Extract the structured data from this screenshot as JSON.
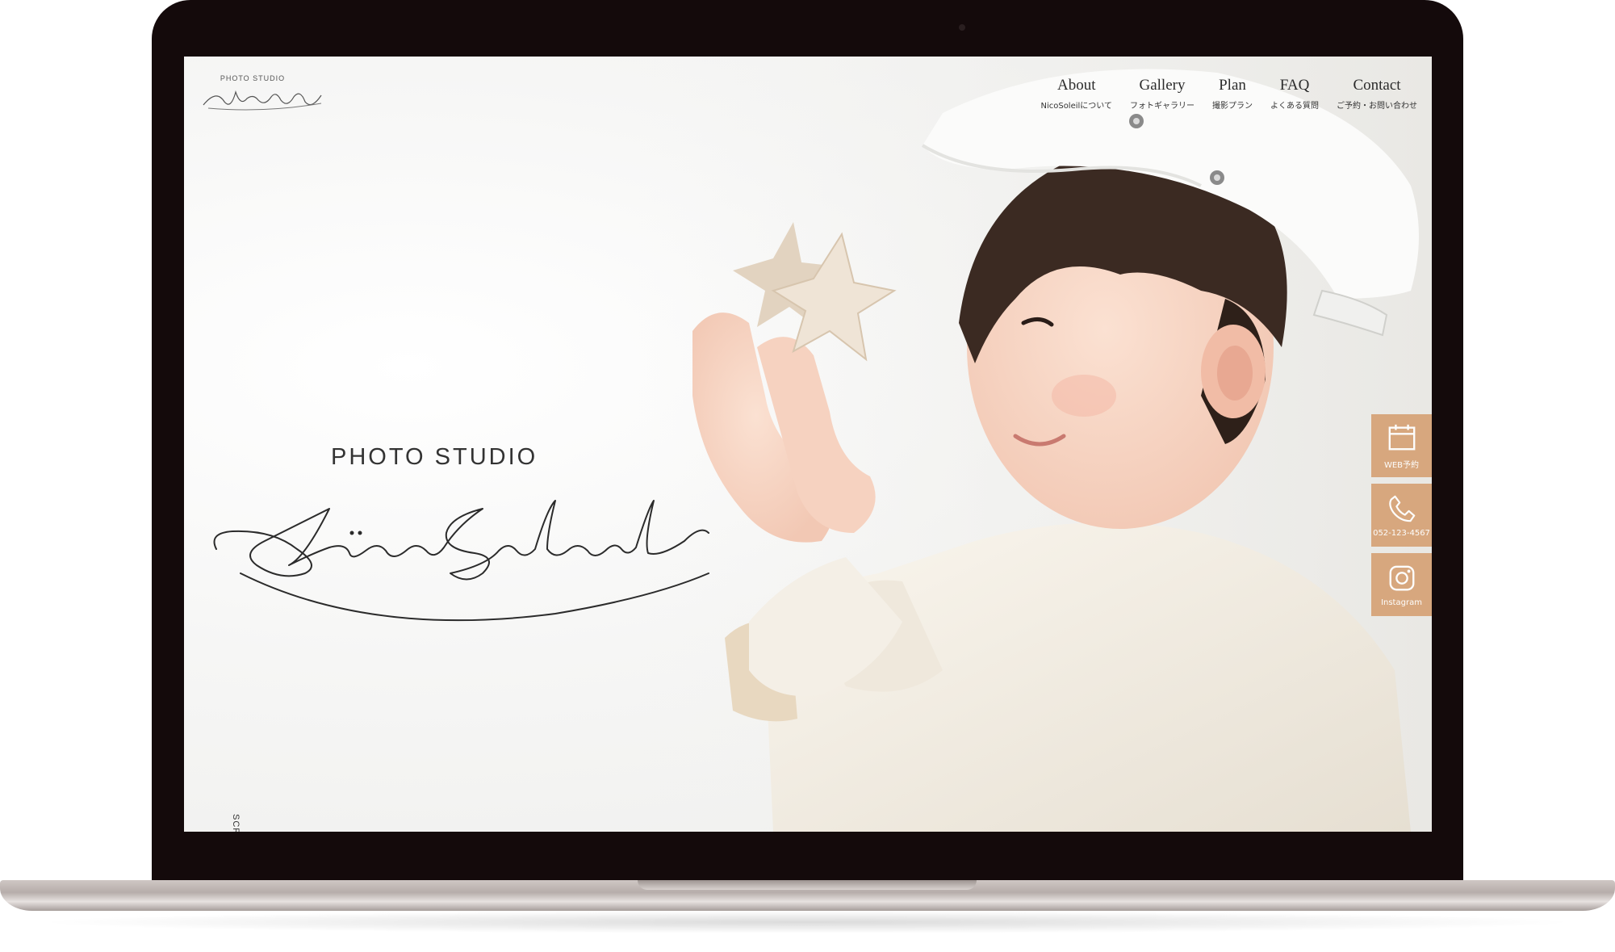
{
  "brand": {
    "small_caption": "PHOTO STUDIO",
    "small_script": "NicoSoleil",
    "hero_caption": "PHOTO STUDIO",
    "hero_script": "NicoSoleil"
  },
  "nav": {
    "items": [
      {
        "en": "About",
        "ja": "NicoSoleilについて"
      },
      {
        "en": "Gallery",
        "ja": "フォトギャラリー"
      },
      {
        "en": "Plan",
        "ja": "撮影プラン"
      },
      {
        "en": "FAQ",
        "ja": "よくある質問"
      },
      {
        "en": "Contact",
        "ja": "ご予約・お問い合わせ"
      }
    ]
  },
  "side_buttons": {
    "web": {
      "label": "WEB予約",
      "icon": "calendar-icon"
    },
    "phone": {
      "label": "052-123-4567",
      "icon": "phone-icon"
    },
    "instagram": {
      "label": "Instagram",
      "icon": "instagram-icon"
    }
  },
  "scroll": {
    "label": "SCROLL"
  },
  "colors": {
    "accent": "#d6a276",
    "bezel": "#140a0b",
    "text": "#2b2b2b"
  }
}
